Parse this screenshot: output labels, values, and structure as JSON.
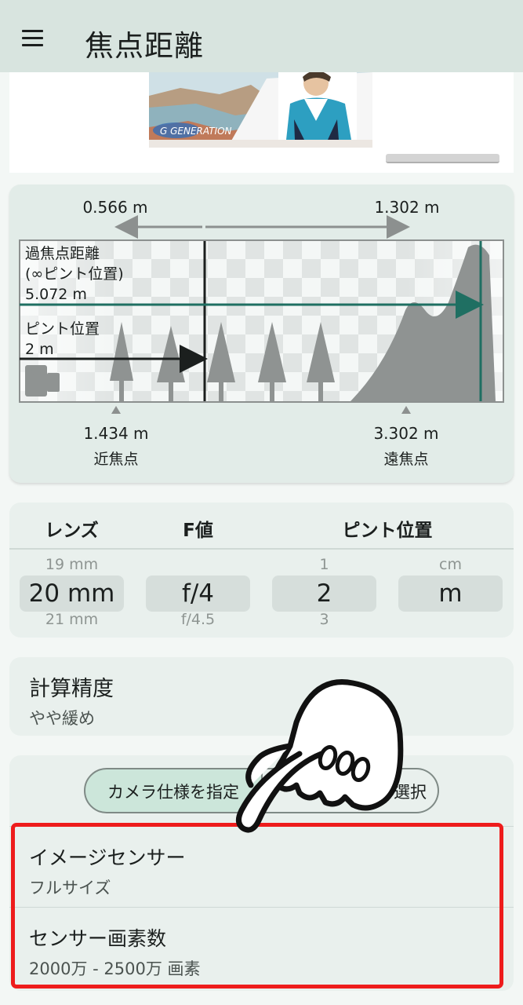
{
  "app": {
    "title": "焦点距離",
    "menu_icon": "hamburger-menu-icon"
  },
  "ad": {
    "banner_text": "G GENERATION"
  },
  "diagram": {
    "near_limit_top": "0.566 m",
    "far_limit_top": "1.302 m",
    "hyperfocal_label_line1": "過焦点距離",
    "hyperfocal_label_line2": "(∞ピント位置)",
    "hyperfocal_value": "5.072 m",
    "focus_label": "ピント位置",
    "focus_value": "2 m",
    "near_point_value": "1.434 m",
    "near_point_label": "近焦点",
    "far_point_value": "3.302 m",
    "far_point_label": "遠焦点",
    "colors": {
      "hyperfocal_arrow": "#1f6f62",
      "focus_arrow": "#1b1f1e",
      "grey_arrow": "#8c908f"
    }
  },
  "picker": {
    "headers": {
      "lens": "レンズ",
      "aperture": "F値",
      "focus": "ピント位置"
    },
    "lens": {
      "prev": "19 mm",
      "current": "20 mm",
      "next": "21 mm"
    },
    "aperture": {
      "prev": "",
      "current": "f/4",
      "next": "f/4.5"
    },
    "focus_value": {
      "prev": "1",
      "current": "2",
      "next": "3"
    },
    "focus_unit": {
      "prev": "cm",
      "current": "m",
      "next": ""
    }
  },
  "accuracy": {
    "title": "計算精度",
    "value": "やや緩め"
  },
  "camera": {
    "segment_left": "カメラ仕様を指定",
    "segment_right": "を選択",
    "sensor_title": "イメージセンサー",
    "sensor_value": "フルサイズ",
    "pixels_title": "センサー画素数",
    "pixels_value": "2000万 - 2500万 画素"
  },
  "overlay": {
    "pointer_icon": "pointing-hand-icon",
    "highlight_color": "#ee1c1c"
  }
}
